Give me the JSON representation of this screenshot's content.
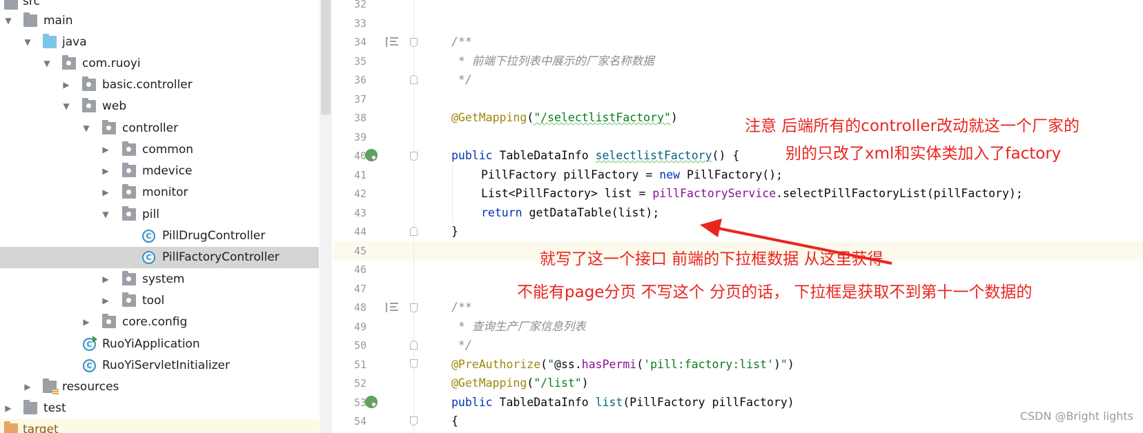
{
  "tree": {
    "items": [
      {
        "label": "src",
        "icon": "folder-icon"
      },
      {
        "label": "main",
        "icon": "folder-icon"
      },
      {
        "label": "java",
        "icon": "source-folder-icon"
      },
      {
        "label": "com.ruoyi",
        "icon": "package-icon"
      },
      {
        "label": "basic.controller",
        "icon": "package-icon"
      },
      {
        "label": "web",
        "icon": "package-icon"
      },
      {
        "label": "controller",
        "icon": "package-icon"
      },
      {
        "label": "common",
        "icon": "package-icon"
      },
      {
        "label": "mdevice",
        "icon": "package-icon"
      },
      {
        "label": "monitor",
        "icon": "package-icon"
      },
      {
        "label": "pill",
        "icon": "package-icon"
      },
      {
        "label": "PillDrugController",
        "icon": "class-icon"
      },
      {
        "label": "PillFactoryController",
        "icon": "class-icon"
      },
      {
        "label": "system",
        "icon": "package-icon"
      },
      {
        "label": "tool",
        "icon": "package-icon"
      },
      {
        "label": "core.config",
        "icon": "package-icon"
      },
      {
        "label": "RuoYiApplication",
        "icon": "spring-boot-class-icon"
      },
      {
        "label": "RuoYiServletInitializer",
        "icon": "class-icon"
      },
      {
        "label": "resources",
        "icon": "resources-folder-icon"
      },
      {
        "label": "test",
        "icon": "folder-icon"
      },
      {
        "label": "target",
        "icon": "excluded-folder-icon"
      }
    ],
    "class_letter": "C"
  },
  "editor": {
    "line_numbers": [
      "32",
      "33",
      "34",
      "35",
      "36",
      "37",
      "38",
      "39",
      "40",
      "41",
      "42",
      "43",
      "44",
      "45",
      "46",
      "47",
      "48",
      "49",
      "50",
      "51",
      "52",
      "53",
      "54"
    ],
    "lines": {
      "l34": "/**",
      "l35": " * 前端下拉列表中展示的厂家名称数据",
      "l36": " */",
      "l38_ann": "@GetMapping",
      "l38_open": "(",
      "l38_str": "\"/selectlistFactory\"",
      "l38_close": ")",
      "l40_kw": "public",
      "l40_type": " TableDataInfo ",
      "l40_fn": "selectlistFactory",
      "l40_rest": "() {",
      "l41_a": "PillFactory pillFactory = ",
      "l41_kw": "new",
      "l41_b": " PillFactory();",
      "l42_a": "List<PillFactory> list = ",
      "l42_fld": "pillFactoryService",
      "l42_b": ".selectPillFactoryList(pillFactory);",
      "l43_kw": "return",
      "l43_b": " getDataTable(list);",
      "l44": "}",
      "l48": "/**",
      "l49": " * 查询生产厂家信息列表",
      "l50": " */",
      "l51_ann": "@PreAuthorize",
      "l51_open": "(",
      "l51_q1": "\"",
      "l51_at": "@ss.",
      "l51_fn": "hasPermi",
      "l51_p": "(",
      "l51_str": "'pill:factory:list'",
      "l51_pc": ")",
      "l51_q2": "\"",
      "l51_close": ")",
      "l52_ann": "@GetMapping",
      "l52_open": "(",
      "l52_str": "\"/list\"",
      "l52_close": ")",
      "l53_kw": "public",
      "l53_type": " TableDataInfo ",
      "l53_fn": "list",
      "l53_rest": "(PillFactory pillFactory)",
      "l54": "{"
    }
  },
  "annotations": {
    "note1_line1": "注意 后端所有的controller改动就这一个厂家的",
    "note1_line2": "别的只改了xml和实体类加入了factory",
    "note2": "就写了这一个接口 前端的下拉框数据 从这里获得",
    "note3": "不能有page分页  不写这个 分页的话， 下拉框是获取不到第十一个数据的",
    "color": "#e8261f"
  },
  "watermark": "CSDN @Bright lights",
  "colors": {
    "keyword": "#0033b3",
    "annotation": "#9e880d",
    "string": "#067d17",
    "comment": "#8c8c8c",
    "field": "#871094",
    "selected_row": "#d5d5d5",
    "current_line": "#fcfaed"
  }
}
